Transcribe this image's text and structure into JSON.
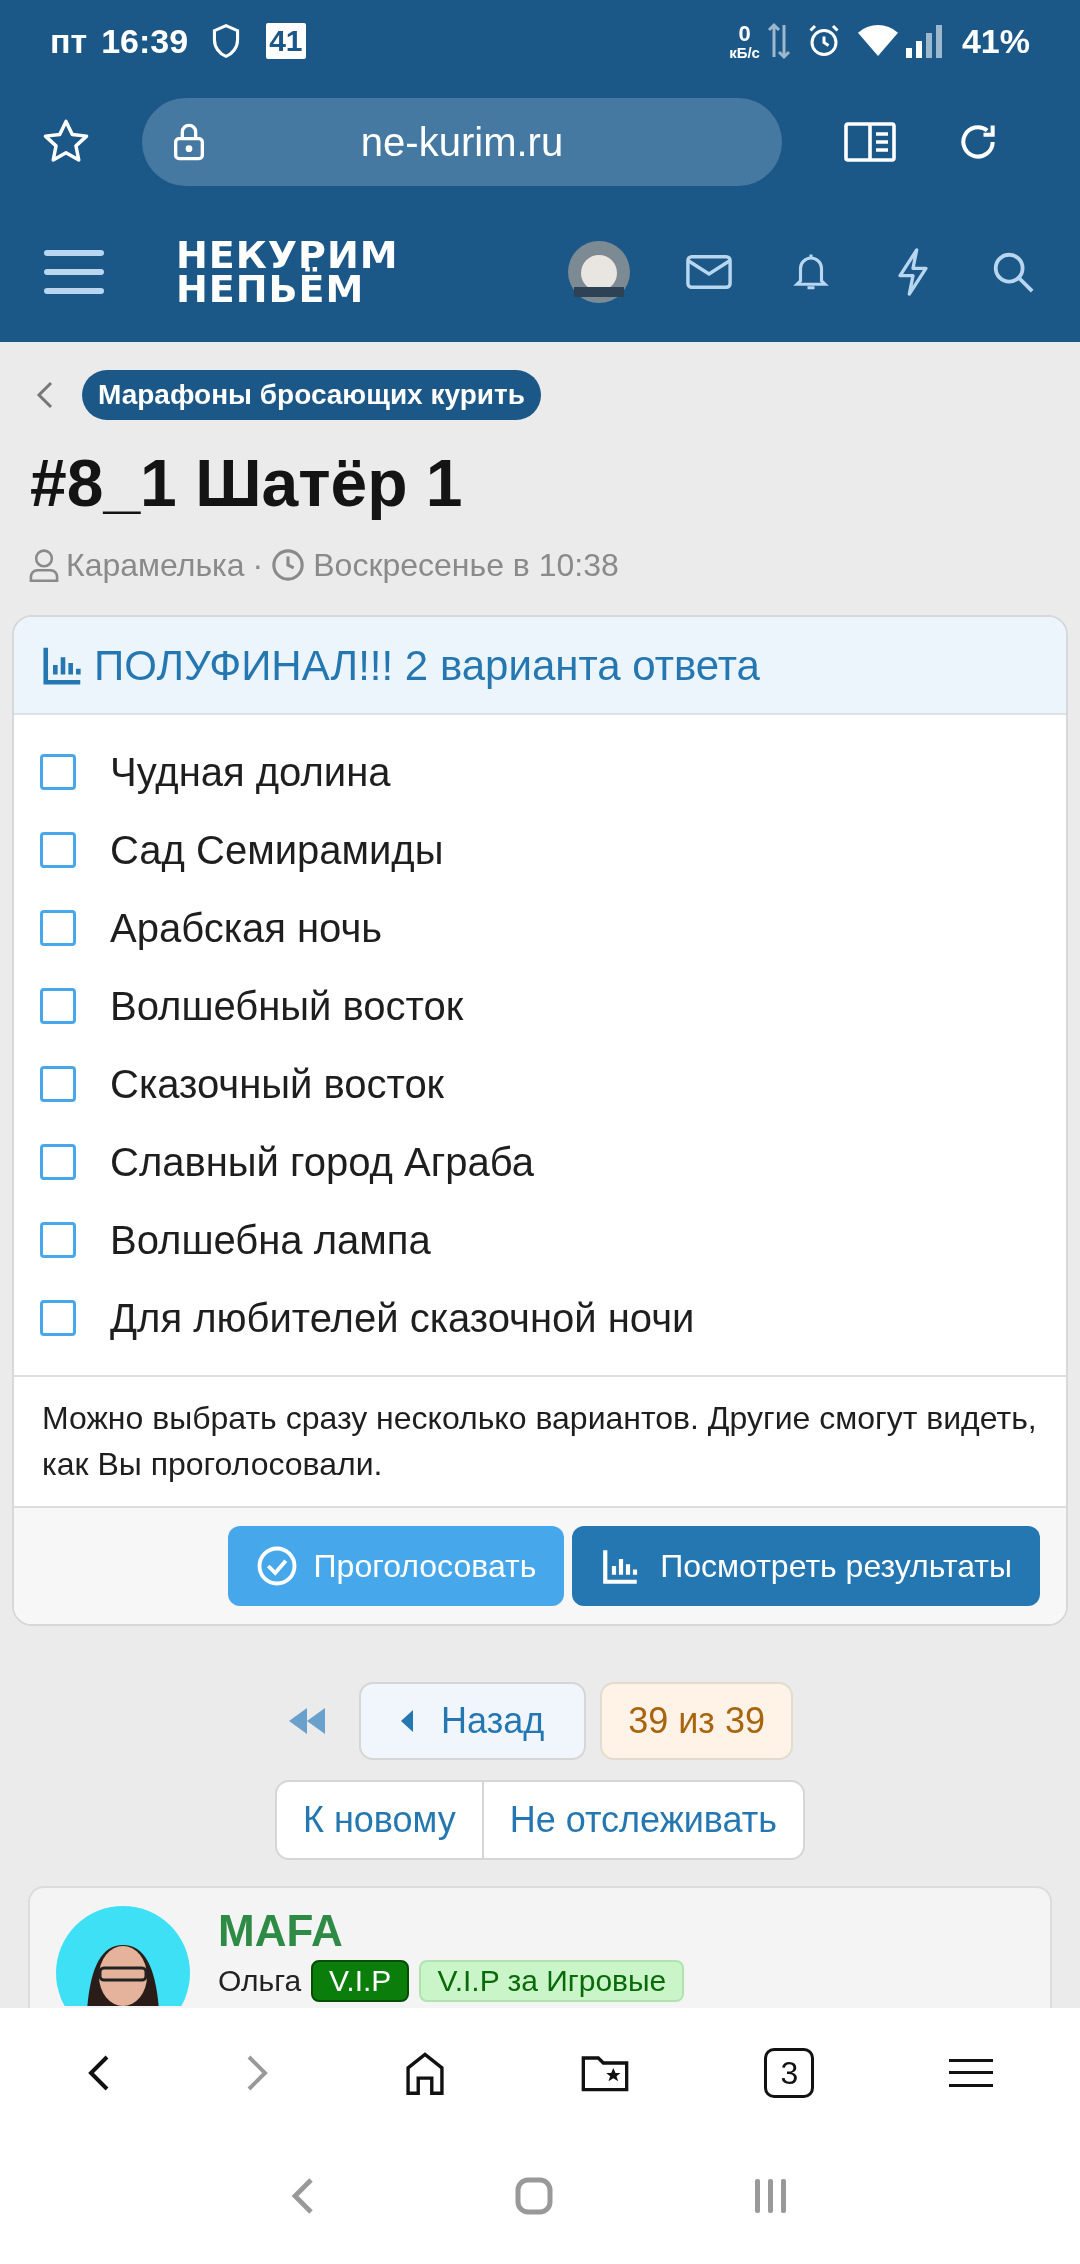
{
  "status_bar": {
    "day": "пт",
    "time": "16:39",
    "calendar_day": "41",
    "speed_value": "0",
    "speed_unit": "кБ/с",
    "battery": "41%"
  },
  "browser": {
    "url": "ne-kurim.ru",
    "tabs_count": "3"
  },
  "site_header": {
    "logo_line_1": "НЕКУРИМ",
    "logo_line_2": "НЕПЬЁМ"
  },
  "breadcrumb": {
    "label": "Марафоны бросающих курить"
  },
  "thread": {
    "title": "#8_1 Шатёр 1",
    "author": "Карамелька",
    "separator": "·",
    "date": "Воскресенье в 10:38"
  },
  "poll": {
    "title": "ПОЛУФИНАЛ!!! 2 варианта ответа",
    "options": [
      {
        "label": "Чудная долина",
        "checked": false
      },
      {
        "label": "Сад Семирамиды",
        "checked": false
      },
      {
        "label": "Арабская ночь",
        "checked": false
      },
      {
        "label": "Волшебный восток",
        "checked": false
      },
      {
        "label": "Сказочный восток",
        "checked": false
      },
      {
        "label": "Славный город Аграба",
        "checked": false
      },
      {
        "label": "Волшебна лампа",
        "checked": false
      },
      {
        "label": "Для любителей сказочной ночи",
        "checked": false
      }
    ],
    "note": "Можно выбрать сразу несколько вариантов. Другие смогут видеть, как Вы проголосовали.",
    "vote_button": "Проголосовать",
    "results_button": "Посмотреть результаты"
  },
  "pagination": {
    "back": "Назад",
    "page": "39 из 39",
    "new": "К новому",
    "unwatch": "Не отслеживать"
  },
  "post": {
    "username": "MAFA",
    "name": "Ольга",
    "badges": [
      {
        "label": "V.I.P",
        "color": "#0a7d0a"
      },
      {
        "label": "V.I.P за Игровые",
        "color": "#c9f5c9"
      }
    ]
  }
}
